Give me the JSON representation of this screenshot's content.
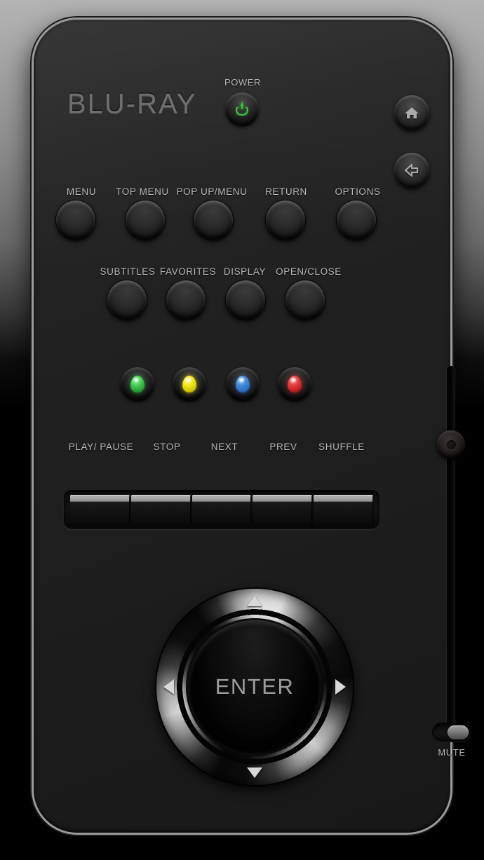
{
  "device": {
    "brand": "BLU-RAY",
    "type": "blu-ray-remote-control"
  },
  "power": {
    "label": "POWER",
    "icon": "power-icon",
    "led_color": "#3ec43e"
  },
  "side_buttons": [
    {
      "label": "",
      "icon": "home-icon",
      "name": "home-button"
    },
    {
      "label": "",
      "icon": "back-arrow-icon",
      "name": "back-button"
    }
  ],
  "menu_row": {
    "buttons": [
      {
        "label": "MENU"
      },
      {
        "label": "TOP MENU"
      },
      {
        "label": "POP UP/MENU"
      },
      {
        "label": "RETURN"
      },
      {
        "label": "OPTIONS"
      }
    ]
  },
  "function_row": {
    "buttons": [
      {
        "label": "SUBTITLES"
      },
      {
        "label": "FAVORITES"
      },
      {
        "label": "DISPLAY"
      },
      {
        "label": "OPEN/CLOSE"
      }
    ]
  },
  "color_row": {
    "buttons": [
      {
        "color_name": "green",
        "color": "#3cb54a"
      },
      {
        "color_name": "yellow",
        "color": "#e8e000"
      },
      {
        "color_name": "blue",
        "color": "#2a6fc4"
      },
      {
        "color_name": "red",
        "color": "#d42020"
      }
    ]
  },
  "transport": {
    "keys": [
      {
        "label": "PLAY/ PAUSE"
      },
      {
        "label": "STOP"
      },
      {
        "label": "NEXT"
      },
      {
        "label": "PREV"
      },
      {
        "label": "SHUFFLE"
      }
    ]
  },
  "dpad": {
    "center_label": "ENTER",
    "up_icon": "arrow-up-icon",
    "down_icon": "arrow-down-icon",
    "left_icon": "arrow-left-icon",
    "right_icon": "arrow-right-icon"
  },
  "volume": {
    "slider_name": "volume-slider",
    "knob_position_percent": 18
  },
  "mute": {
    "label": "MUTE",
    "state": "on"
  },
  "colors": {
    "body": "#232323",
    "bezel": "#9b9b9b",
    "label_text": "#b9b9b9",
    "brand_text": "#6e6e6e"
  }
}
